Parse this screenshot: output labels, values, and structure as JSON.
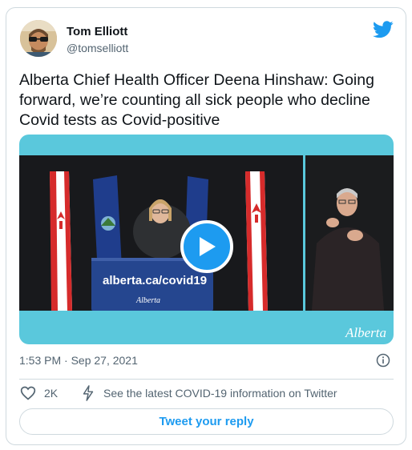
{
  "tweet": {
    "author_name": "Tom Elliott",
    "author_handle": "@tomselliott",
    "text": "Alberta Chief Health Officer Deena Hinshaw: Going forward, we’re counting all sick people who decline Covid tests as Covid-positive",
    "timestamp": "1:53 PM · Sep 27, 2021",
    "likes": "2K",
    "covid_link": "See the latest COVID-19 information on Twitter",
    "reply_label": "Tweet your reply"
  },
  "video": {
    "podium_text": "alberta.ca/covid19",
    "podium_logo": "Alberta",
    "watermark": "Alberta"
  },
  "colors": {
    "accent": "#1d9bf0",
    "media_frame": "#5ac8dc",
    "secondary_text": "#536471",
    "border": "#cfd9de"
  },
  "icons": [
    "twitter-bird-icon",
    "play-icon",
    "info-icon",
    "heart-icon",
    "lightning-icon"
  ]
}
